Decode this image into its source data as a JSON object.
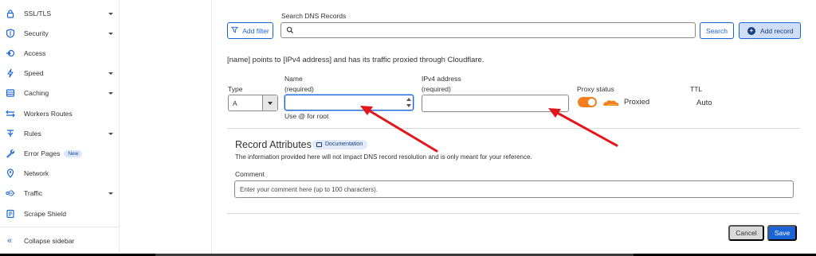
{
  "sidebar": {
    "items": [
      {
        "label": "SSL/TLS",
        "icon": "lock-icon",
        "has_caret": true
      },
      {
        "label": "Security",
        "icon": "shield-icon",
        "has_caret": true
      },
      {
        "label": "Access",
        "icon": "access-icon",
        "has_caret": false
      },
      {
        "label": "Speed",
        "icon": "lightning-icon",
        "has_caret": true
      },
      {
        "label": "Caching",
        "icon": "caching-icon",
        "has_caret": true
      },
      {
        "label": "Workers Routes",
        "icon": "workers-icon",
        "has_caret": false
      },
      {
        "label": "Rules",
        "icon": "rules-icon",
        "has_caret": true
      },
      {
        "label": "Error Pages",
        "icon": "wrench-icon",
        "has_caret": false,
        "badge": "New"
      },
      {
        "label": "Network",
        "icon": "location-pin-icon",
        "has_caret": false
      },
      {
        "label": "Traffic",
        "icon": "traffic-icon",
        "has_caret": true
      },
      {
        "label": "Scrape Shield",
        "icon": "document-icon",
        "has_caret": false
      }
    ],
    "collapse_label": "Collapse sidebar"
  },
  "toolbar": {
    "add_filter_label": "Add filter",
    "search_label": "Search DNS Records",
    "search_value": "",
    "search_button_label": "Search",
    "add_record_label": "Add record"
  },
  "info_text": "[name] points to [IPv4 address] and has its traffic proxied through Cloudflare.",
  "form": {
    "type_label": "Type",
    "type_value": "A",
    "name_label": "Name",
    "name_required": "(required)",
    "name_value": "",
    "name_hint": "Use @ for root",
    "ipv4_label": "IPv4 address",
    "ipv4_required": "(required)",
    "ipv4_value": "",
    "proxy_label": "Proxy status",
    "proxy_value": "Proxied",
    "ttl_label": "TTL",
    "ttl_value": "Auto"
  },
  "attributes": {
    "title": "Record Attributes",
    "doc_badge": "Documentation",
    "description": "The information provided here will not impact DNS record resolution and is only meant for your reference.",
    "comment_label": "Comment",
    "comment_placeholder": "Enter your comment here (up to 100 characters).",
    "comment_value": ""
  },
  "actions": {
    "cancel_label": "Cancel",
    "save_label": "Save"
  },
  "colors": {
    "accent": "#1b64d6",
    "proxy_orange": "#f38020",
    "annotation_arrow": "#e3171b"
  }
}
